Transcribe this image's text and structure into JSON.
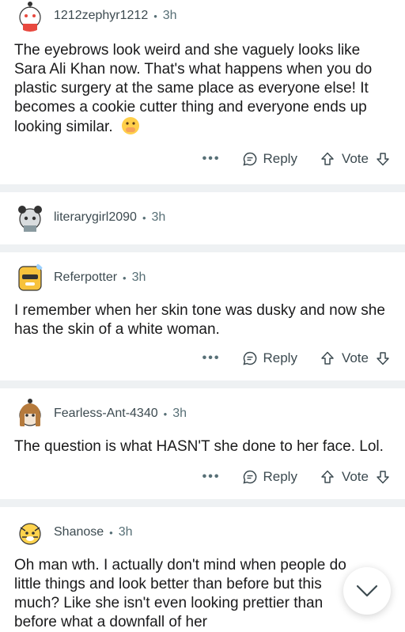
{
  "comments": [
    {
      "user": "1212zephyr1212",
      "time": "3h",
      "text": "The eyebrows look weird and she vaguely looks like Sara Ali Khan now. That's what happens when you do plastic surgery at the same place as everyone else! It becomes a cookie cutter thing and everyone ends up looking similar.",
      "emoji": "face-with-hand-over-mouth",
      "reply_label": "Reply",
      "vote_label": "Vote"
    },
    {
      "user": "literarygirl2090",
      "time": "3h"
    },
    {
      "user": "Referpotter",
      "time": "3h",
      "text": "I remember when her skin tone was dusky and now she has the skin of a white woman.",
      "reply_label": "Reply",
      "vote_label": "Vote"
    },
    {
      "user": "Fearless-Ant-4340",
      "time": "3h",
      "text": "The question is what HASN'T she done to her face. Lol.",
      "reply_label": "Reply",
      "vote_label": "Vote"
    },
    {
      "user": "Shanose",
      "time": "3h",
      "text": "Oh man wth. I actually don't mind when people do little things and look better than before but this much? Like she isn't even looking prettier than before what a downfall of her"
    }
  ],
  "more_label": "•••",
  "icons": {
    "reply": "comment-bubble-icon",
    "upvote": "arrow-up-icon",
    "downvote": "arrow-down-icon",
    "scroll": "chevron-down-icon"
  },
  "colors": {
    "meta": "#576f76",
    "separator": "#eef1f3"
  }
}
